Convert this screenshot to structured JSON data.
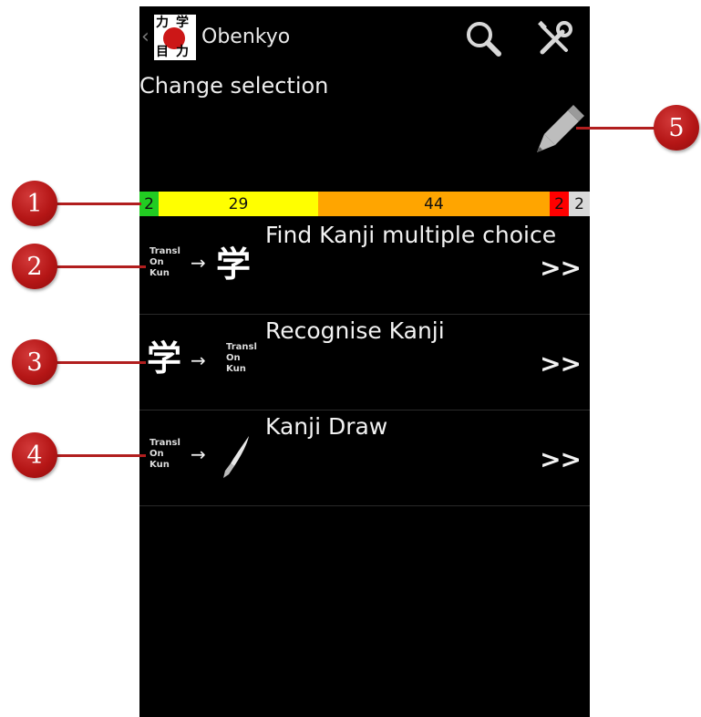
{
  "app": {
    "title": "Obenkyo",
    "icon_chars": [
      "力",
      "学",
      "目",
      "力"
    ]
  },
  "actionbar": {
    "back_icon": "chevron-left-icon",
    "search_icon": "search-icon",
    "settings_icon": "tools-icon"
  },
  "selection": {
    "label": "Change selection",
    "edit_icon": "pencil-icon"
  },
  "progress": {
    "segments": [
      {
        "value": "2",
        "color": "#22cc22"
      },
      {
        "value": "29",
        "color": "#ffff00"
      },
      {
        "value": "44",
        "color": "#ffa500"
      },
      {
        "value": "2",
        "color": "#ff0000"
      },
      {
        "value": "2",
        "color": "#d9d9d9"
      }
    ]
  },
  "modes": [
    {
      "title": "Find Kanji multiple choice",
      "meta": [
        "Transl",
        "On",
        "Kun"
      ],
      "arrow": "→",
      "target": "学",
      "chevron": ">>"
    },
    {
      "title": "Recognise Kanji",
      "source": "学",
      "arrow": "→",
      "meta": [
        "Transl",
        "On",
        "Kun"
      ],
      "chevron": ">>"
    },
    {
      "title": "Kanji Draw",
      "meta": [
        "Transl",
        "On",
        "Kun"
      ],
      "arrow": "→",
      "target_icon": "brush-icon",
      "chevron": ">>"
    }
  ],
  "callouts": [
    "1",
    "2",
    "3",
    "4",
    "5"
  ],
  "colors": {
    "background": "#000000",
    "callout": "#b51616"
  }
}
